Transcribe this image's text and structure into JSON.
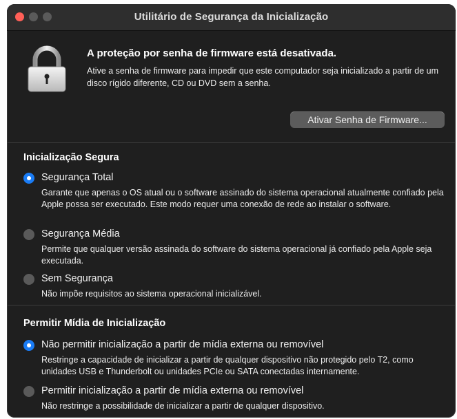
{
  "window": {
    "title": "Utilitário de Segurança da Inicialização"
  },
  "firmware": {
    "title": "A proteção por senha de firmware está desativada.",
    "description": "Ative a senha de firmware para impedir que este computador seja inicializado a partir de um disco rígido diferente, CD ou DVD sem a senha.",
    "button_label": "Ativar Senha de Firmware..."
  },
  "secure_boot": {
    "heading": "Inicialização Segura",
    "options": [
      {
        "label": "Segurança Total",
        "description": "Garante que apenas o OS atual ou o software assinado do sistema operacional atualmente confiado pela Apple possa ser executado. Este modo requer uma conexão de rede ao instalar o software.",
        "selected": true
      },
      {
        "label": "Segurança Média",
        "description": "Permite que qualquer versão assinada do software do sistema operacional já confiado pela Apple seja executada.",
        "selected": false
      },
      {
        "label": "Sem Segurança",
        "description": "Não impõe requisitos ao sistema operacional inicializável.",
        "selected": false
      }
    ]
  },
  "boot_media": {
    "heading": "Permitir Mídia de Inicialização",
    "options": [
      {
        "label": "Não permitir inicialização a partir de mídia externa ou removível",
        "description": "Restringe a capacidade de inicializar a partir de qualquer dispositivo não protegido pelo T2, como unidades USB e Thunderbolt ou unidades PCIe ou SATA conectadas internamente.",
        "selected": true
      },
      {
        "label": "Permitir inicialização a partir de mídia externa ou removível",
        "description": "Não restringe a possibilidade de inicializar a partir de qualquer dispositivo.",
        "selected": false
      }
    ]
  },
  "icons": {
    "lock": "padlock-icon"
  },
  "colors": {
    "window_bg": "#1f1f1f",
    "titlebar_bg": "#2e2e2e",
    "close_button": "#ff5f57",
    "radio_selected": "#1a7cf5",
    "radio_unselected": "#5a5a5a",
    "button_bg": "#5c5c5c"
  }
}
